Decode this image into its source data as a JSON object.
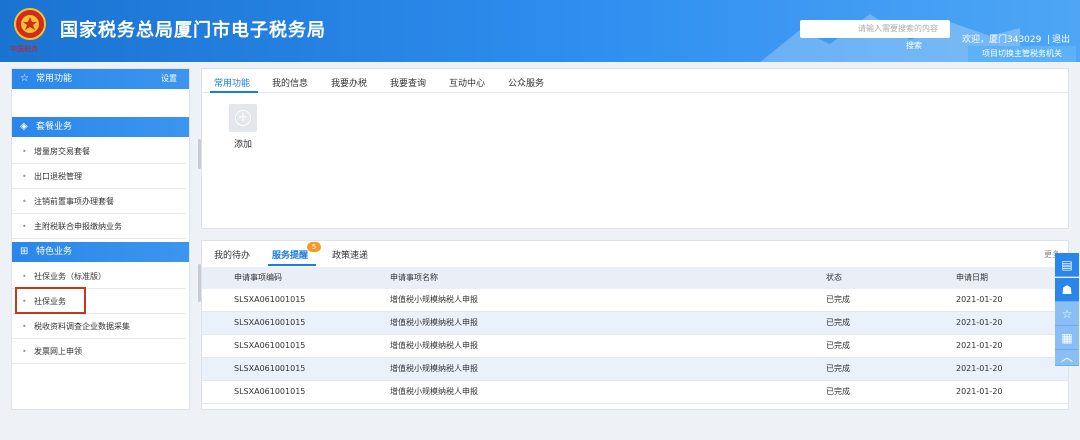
{
  "header": {
    "emblem_text": "中国税务",
    "title": "国家税务总局厦门市电子税务局",
    "search_placeholder": "请输入需要搜索的内容",
    "search_button": "搜索",
    "welcome": "欢迎，厦门343029",
    "logout": "退出",
    "switch_button": "项目切换主管税务机关"
  },
  "sidebar": {
    "common": {
      "title": "常用功能",
      "settings": "设置"
    },
    "package": {
      "title": "套餐业务",
      "items": [
        "增量房交易套餐",
        "出口退税管理",
        "注销前置事项办理套餐",
        "主附税联合申报缴纳业务"
      ]
    },
    "special": {
      "title": "特色业务",
      "items": [
        "社保业务（标准版）",
        "社保业务",
        "税收资料调查企业数据采集",
        "发票网上申领"
      ]
    }
  },
  "top_panel": {
    "tabs": [
      "常用功能",
      "我的信息",
      "我要办税",
      "我要查询",
      "互动中心",
      "公众服务"
    ],
    "add_label": "添加"
  },
  "bottom_panel": {
    "tabs": [
      "我的待办",
      "服务提醒",
      "政策速递"
    ],
    "badge": "5",
    "more": "更多",
    "columns": [
      "申请事项编码",
      "申请事项名称",
      "状态",
      "申请日期"
    ],
    "rows": [
      [
        "SLSXA061001015",
        "增值税小规模纳税人申报",
        "已完成",
        "2021-01-20"
      ],
      [
        "SLSXA061001015",
        "增值税小规模纳税人申报",
        "已完成",
        "2021-01-20"
      ],
      [
        "SLSXA061001015",
        "增值税小规模纳税人申报",
        "已完成",
        "2021-01-20"
      ],
      [
        "SLSXA061001015",
        "增值税小规模纳税人申报",
        "已完成",
        "2021-01-20"
      ],
      [
        "SLSXA061001015",
        "增值税小规模纳税人申报",
        "已完成",
        "2021-01-20"
      ]
    ]
  },
  "colors": {
    "header_blue": "#1a73d1",
    "accent": "#1c7be0",
    "highlight_red": "#c23a1a",
    "badge_orange": "#f59a23"
  }
}
